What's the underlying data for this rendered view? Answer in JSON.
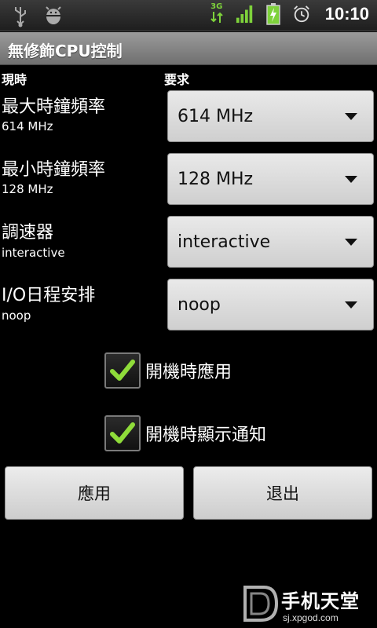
{
  "status_bar": {
    "time": "10:10",
    "network_type": "3G",
    "icons": [
      "usb-icon",
      "android-debug-icon",
      "3g-data-icon",
      "signal-icon",
      "battery-charging-icon",
      "alarm-icon"
    ]
  },
  "app": {
    "title": "無修飾CPU控制"
  },
  "columns": {
    "current": "現時",
    "requested": "要求"
  },
  "rows": [
    {
      "label": "最大時鐘頻率",
      "current": "614 MHz",
      "selected": "614 MHz"
    },
    {
      "label": "最小時鐘頻率",
      "current": "128 MHz",
      "selected": "128 MHz"
    },
    {
      "label": "調速器",
      "current": "interactive",
      "selected": "interactive"
    },
    {
      "label": "I/O日程安排",
      "current": "noop",
      "selected": "noop"
    }
  ],
  "options": [
    {
      "label": "開機時應用",
      "checked": true
    },
    {
      "label": "開機時顯示通知",
      "checked": true
    }
  ],
  "buttons": {
    "apply": "應用",
    "exit": "退出"
  },
  "watermark": {
    "name": "手机天堂",
    "url": "sj.xpgod.com"
  },
  "colors": {
    "check": "#8fdc3a",
    "title_bar": "#8a8a8a",
    "spinner": "#dcdcdc"
  }
}
